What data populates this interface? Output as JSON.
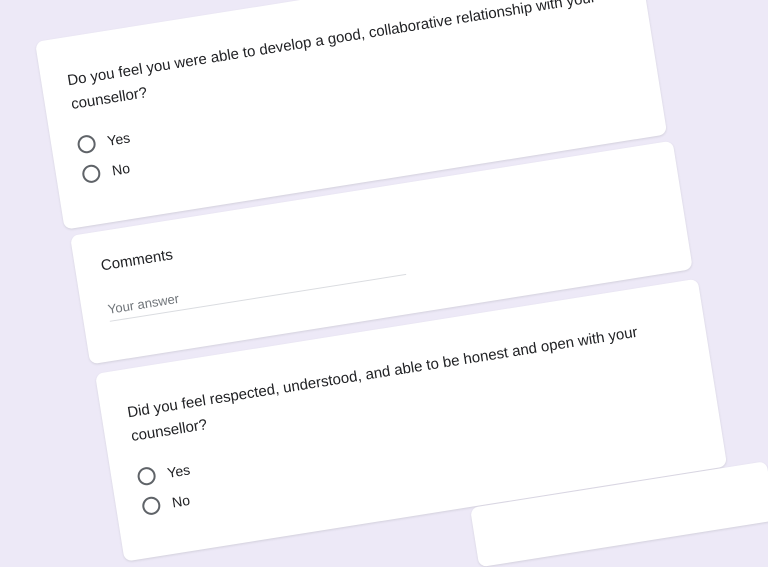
{
  "q1": {
    "text": "Do you feel you were able to develop a good, collaborative relationship with your counsellor?",
    "options": [
      "Yes",
      "No"
    ]
  },
  "comments": {
    "title": "Comments",
    "placeholder": "Your answer"
  },
  "q2": {
    "text": "Did you feel respected, understood, and able to be honest and open with your counsellor?",
    "options": [
      "Yes",
      "No"
    ]
  },
  "colors": {
    "background": "#ede9f7",
    "card": "#ffffff",
    "text": "#202124"
  }
}
